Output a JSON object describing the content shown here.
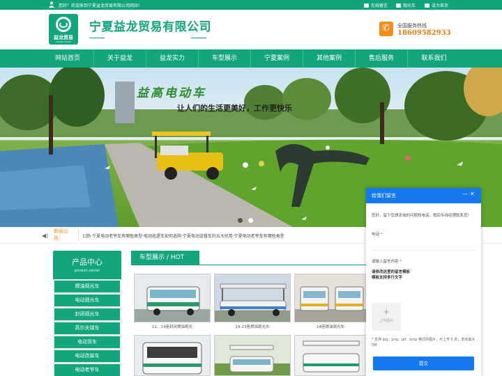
{
  "topbar": {
    "welcome": "您好！欢迎来到宁夏益龙贸易有限公司网站！",
    "links": [
      {
        "label": "在线留言",
        "icon": "message-icon"
      },
      {
        "label": "观光车",
        "icon": "document-icon"
      },
      {
        "label": "设为首页",
        "icon": "home-icon"
      }
    ]
  },
  "header": {
    "logo_text": "益龙贸易",
    "logo_sub": "YILONG TRADE",
    "company_name": "宁夏益龙贸易有限公司",
    "hotline_label": "全国服务热线",
    "hotline_number": "18609582933"
  },
  "nav": {
    "items": [
      "网站首页",
      "关于益龙",
      "益龙实力",
      "车型展示",
      "宁夏案例",
      "其他案例",
      "售后服务",
      "联系我们"
    ]
  },
  "banner": {
    "slogan_main": "益高电动车",
    "slogan_sub": "让人们的生活更美好，工作更快乐",
    "slide_count": 2,
    "active_slide": 1
  },
  "news": {
    "label": "新闻公告：",
    "text": "1]热·宁夏电动老爷车有哪些类型·电动巡逻车如何选购·宁夏电动送餐车的五大优势·宁夏电动老爷车有哪些类型"
  },
  "sidebar": {
    "title": "产品中心",
    "subtitle": "product center",
    "items": [
      "燃油观光车",
      "电动观光车",
      "封闭观光车",
      "高尔夫球车",
      "电动货车",
      "电动改装车",
      "电动老爷车"
    ]
  },
  "products": {
    "section_title": "车型展示 / HOT",
    "items": [
      {
        "caption": "11、14座封闭燃油观光"
      },
      {
        "caption": "19-23座燃油观光车"
      },
      {
        "caption": "14座燃油观光车"
      },
      {
        "caption": ""
      },
      {
        "caption": ""
      },
      {
        "caption": ""
      }
    ]
  },
  "message_panel": {
    "title": "给我们留言",
    "minimize": "—",
    "close": "✕",
    "intro": "您好，留下您想咨询的问题和电话，稍后专线经理联系您！",
    "phone_label": "电话",
    "content_label": "请输入留言内容",
    "template_line1": "请修改这里的留言模板",
    "template_line2": "模板支持多行文字",
    "upload_label": "上传图片",
    "upload_hint": "* 支持 jpg、png、gif、bmp 格式的图片，可上传 5 张，单张最大 5M",
    "submit": "提交"
  },
  "colors": {
    "brand_green": "#12a57e",
    "hotline_orange": "#f27c10",
    "panel_blue": "#1478f0"
  }
}
